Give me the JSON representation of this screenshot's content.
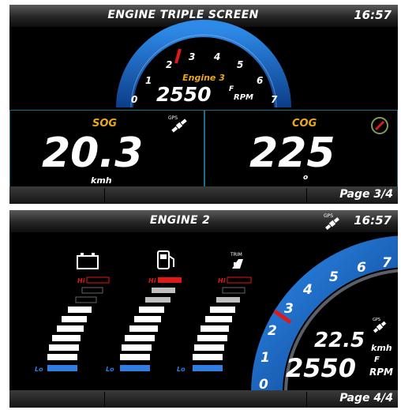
{
  "screen1": {
    "title": "ENGINE TRIPLE SCREEN",
    "time": "16:57",
    "gauge": {
      "engine_label": "Engine 3",
      "rpm_value": "2550",
      "rpm_f": "F",
      "rpm_unit": "RPM",
      "scale": [
        "0",
        "1",
        "2",
        "3",
        "4",
        "5",
        "6",
        "7"
      ]
    },
    "sog": {
      "label": "SOG",
      "value": "20.3",
      "unit": "kmh"
    },
    "cog": {
      "label": "COG",
      "value": "225",
      "unit": "o"
    },
    "page": "Page 3/4"
  },
  "screen2": {
    "title": "ENGINE 2",
    "time": "16:57",
    "gps_label": "GPS",
    "bars": [
      {
        "icon": "battery-icon",
        "hi": "Hi",
        "lo": "Lo"
      },
      {
        "icon": "fuel-pump-icon",
        "hi": "Hi",
        "lo": "Lo"
      },
      {
        "icon": "trim-icon",
        "trim_text": "TRIM",
        "hi": "Hi",
        "lo": "Lo"
      }
    ],
    "gauge": {
      "scale": [
        "0",
        "1",
        "2",
        "3",
        "4",
        "5",
        "6",
        "7"
      ],
      "speed_value": "22.5",
      "speed_unit": "kmh",
      "rpm_value": "2550",
      "rpm_f": "F",
      "rpm_unit": "RPM"
    },
    "page": "Page 4/4"
  },
  "colors": {
    "accent_orange": "#e8a81c",
    "gauge_blue": "#1a6ec8",
    "needle_red": "#e01818",
    "hi_red": "#e01818",
    "lo_blue": "#2f7ee0"
  }
}
